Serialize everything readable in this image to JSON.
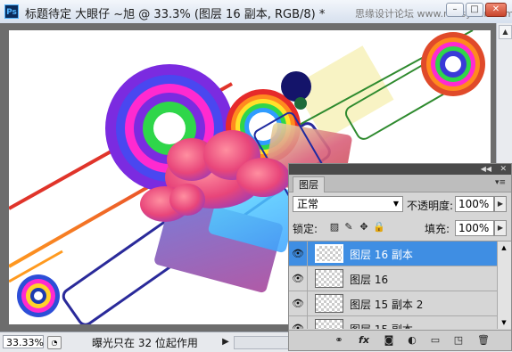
{
  "window": {
    "app_badge": "Ps",
    "title": "标题待定    大眼仔 ~旭 @ 33.3% (图层 16 副本, RGB/8) *",
    "watermark": "思缘设计论坛 www.missyuan.com",
    "controls": {
      "minimize": "–",
      "maximize": "□",
      "close": "✕"
    }
  },
  "status": {
    "zoom": "33.33%",
    "message": "曝光只在 32 位起作用",
    "arrow": "▶"
  },
  "layers_panel": {
    "tab": "图层",
    "blend_mode": "正常",
    "opacity_label": "不透明度:",
    "opacity_value": "100%",
    "lock_label": "锁定:",
    "fill_label": "填充:",
    "fill_value": "100%",
    "layers": [
      {
        "name": "图层 16 副本",
        "selected": true
      },
      {
        "name": "图层 16",
        "selected": false
      },
      {
        "name": "图层 15 副本 2",
        "selected": false
      },
      {
        "name": "图层 15 副本",
        "selected": false
      }
    ],
    "footer_icons": [
      "link-icon",
      "fx-icon",
      "mask-icon",
      "adjustment-icon",
      "folder-icon",
      "new-layer-icon",
      "trash-icon"
    ],
    "footer_glyphs": [
      "⚭",
      "fx",
      "◙",
      "◐",
      "▭",
      "◳",
      "🗑"
    ]
  },
  "colors": {
    "selection": "#3f8ee3",
    "canvas_bg": "#ffffff",
    "workspace": "#6d6d6d"
  }
}
